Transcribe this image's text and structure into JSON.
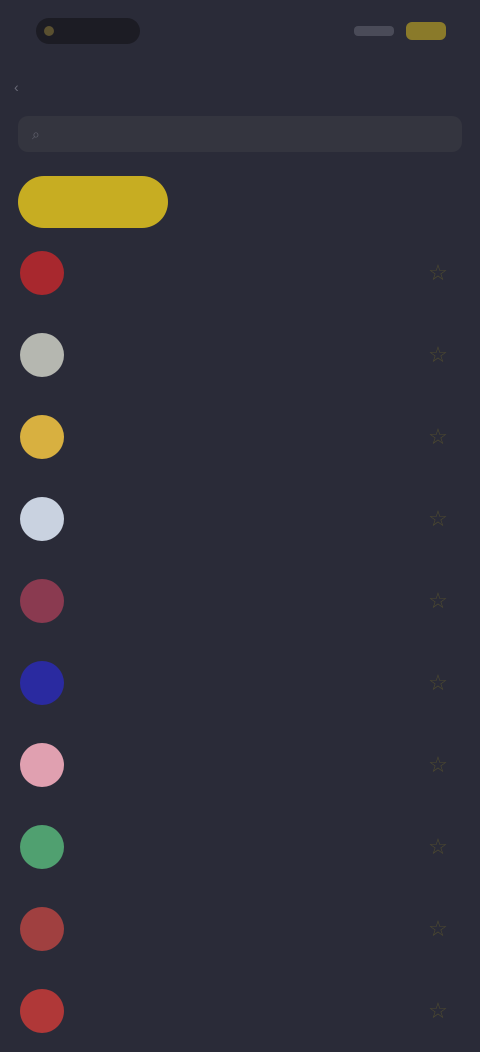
{
  "status": {
    "time": "",
    "icons": [
      "signal-icon",
      "battery-icon"
    ]
  },
  "nav": {
    "back_label": "",
    "title": ""
  },
  "search": {
    "placeholder": ""
  },
  "tabs": [
    {
      "label": "",
      "active": true
    },
    {
      "label": "",
      "active": false
    },
    {
      "label": "",
      "active": false
    }
  ],
  "colors": {
    "accent": "#c7ad22",
    "background": "#2a2b38"
  },
  "rows": [
    {
      "name": "",
      "info": "",
      "flag": "flag-icon",
      "flag_color": "#a8282e"
    },
    {
      "name": "",
      "info": "",
      "flag": "flag-icon",
      "flag_color": "#b5b7b0"
    },
    {
      "name": "",
      "info": "",
      "flag": "flag-icon",
      "flag_color": "#d8b040"
    },
    {
      "name": "",
      "info": "",
      "flag": "flag-icon",
      "flag_color": "#c9d2e0"
    },
    {
      "name": "",
      "info": "",
      "flag": "flag-icon",
      "flag_color": "#8a3a50"
    },
    {
      "name": "",
      "info": "",
      "flag": "flag-icon",
      "flag_color": "#2a2aa0"
    },
    {
      "name": "",
      "info": "",
      "flag": "flag-icon",
      "flag_color": "#e0a0b0"
    },
    {
      "name": "",
      "info": "",
      "flag": "flag-icon",
      "flag_color": "#50a070"
    },
    {
      "name": "",
      "info": "",
      "flag": "flag-icon",
      "flag_color": "#a04040"
    },
    {
      "name": "",
      "info": "",
      "flag": "flag-icon",
      "flag_color": "#b03838"
    }
  ]
}
